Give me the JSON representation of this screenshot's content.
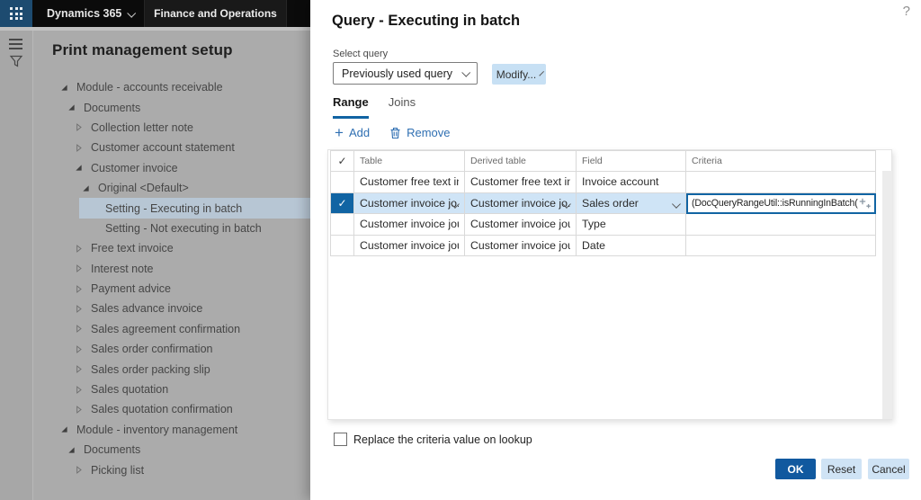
{
  "colors": {
    "navbar_bg": "#0b0b0b",
    "navbar_mid_bg": "#191919",
    "waffle_bg": "#1d4b70",
    "dim_bg": "#ababab",
    "rail_bg": "#a7a7a7",
    "tree_sel_bg": "#b7c6d4",
    "accent": "#1164a3",
    "ok_bg": "#11599f",
    "light_btn_bg": "#cfe3f5",
    "modify_bg": "#c7e0f4",
    "row_sel_bg": "#cfe4f6",
    "link_blue": "#2f6fb2",
    "grid_border": "#d9d9d9"
  },
  "topbar": {
    "app": "Dynamics 365",
    "suite": "Finance and Operations"
  },
  "help_label": "?",
  "page": {
    "title": "Print management setup",
    "tree": [
      {
        "label": "Module - accounts receivable",
        "level": 0,
        "state": "expanded",
        "selected": false
      },
      {
        "label": "Documents",
        "level": 1,
        "state": "expanded",
        "selected": false
      },
      {
        "label": "Collection letter note",
        "level": 2,
        "state": "collapsed",
        "selected": false
      },
      {
        "label": "Customer account statement",
        "level": 2,
        "state": "collapsed",
        "selected": false
      },
      {
        "label": "Customer invoice",
        "level": 2,
        "state": "expanded",
        "selected": false
      },
      {
        "label": "Original <Default>",
        "level": 3,
        "state": "expanded",
        "selected": false
      },
      {
        "label": "Setting - Executing in batch",
        "level": 4,
        "state": "leaf",
        "selected": true
      },
      {
        "label": "Setting - Not executing in batch",
        "level": 4,
        "state": "leaf",
        "selected": false
      },
      {
        "label": "Free text invoice",
        "level": 2,
        "state": "collapsed",
        "selected": false
      },
      {
        "label": "Interest note",
        "level": 2,
        "state": "collapsed",
        "selected": false
      },
      {
        "label": "Payment advice",
        "level": 2,
        "state": "collapsed",
        "selected": false
      },
      {
        "label": "Sales advance invoice",
        "level": 2,
        "state": "collapsed",
        "selected": false
      },
      {
        "label": "Sales agreement confirmation",
        "level": 2,
        "state": "collapsed",
        "selected": false
      },
      {
        "label": "Sales order confirmation",
        "level": 2,
        "state": "collapsed",
        "selected": false
      },
      {
        "label": "Sales order packing slip",
        "level": 2,
        "state": "collapsed",
        "selected": false
      },
      {
        "label": "Sales quotation",
        "level": 2,
        "state": "collapsed",
        "selected": false
      },
      {
        "label": "Sales quotation confirmation",
        "level": 2,
        "state": "collapsed",
        "selected": false
      },
      {
        "label": "Module - inventory management",
        "level": 0,
        "state": "expanded",
        "selected": false
      },
      {
        "label": "Documents",
        "level": 1,
        "state": "expanded",
        "selected": false
      },
      {
        "label": "Picking list",
        "level": 2,
        "state": "collapsed",
        "selected": false
      }
    ]
  },
  "dialog": {
    "title": "Query - Executing in batch",
    "select_query_label": "Select query",
    "select_query_value": "Previously used query",
    "modify_label": "Modify...",
    "tabs": [
      {
        "label": "Range",
        "active": true
      },
      {
        "label": "Joins",
        "active": false
      }
    ],
    "toolbar": {
      "add_label": "Add",
      "add_glyph": "+",
      "remove_label": "Remove"
    },
    "grid": {
      "select_all_glyph": "✓",
      "columns": [
        "Table",
        "Derived table",
        "Field",
        "Criteria"
      ],
      "rows": [
        {
          "table": "Customer free text inv...",
          "derived": "Customer free text inv...",
          "field": "Invoice account",
          "criteria": "",
          "selected": false
        },
        {
          "table": "Customer invoice jo...",
          "derived": "Customer invoice jo...",
          "field": "Sales order",
          "criteria": "(DocQueryRangeUtil::isRunningInBatch())",
          "selected": true
        },
        {
          "table": "Customer invoice jour...",
          "derived": "Customer invoice jour...",
          "field": "Type",
          "criteria": "",
          "selected": false
        },
        {
          "table": "Customer invoice jour...",
          "derived": "Customer invoice jour...",
          "field": "Date",
          "criteria": "",
          "selected": false
        }
      ]
    },
    "checkbox_label": "Replace the criteria value on lookup",
    "footer": {
      "ok_label": "OK",
      "reset_label": "Reset",
      "cancel_label": "Cancel"
    }
  }
}
